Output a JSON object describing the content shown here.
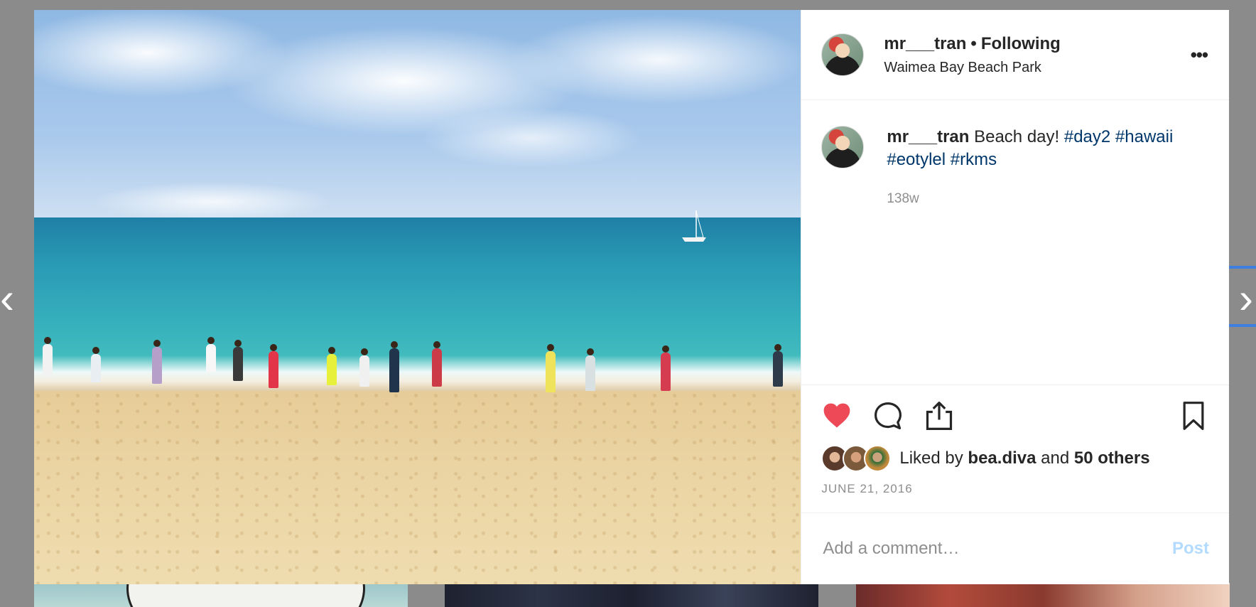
{
  "post": {
    "username": "mr___tran",
    "separator": "•",
    "follow_status": "Following",
    "location": "Waimea Bay Beach Park",
    "more_label": "•••"
  },
  "caption": {
    "username": "mr___tran",
    "text": "Beach day!",
    "hashtags": [
      "#day2",
      "#hawaii",
      "#eotylel",
      "#rkms"
    ],
    "age": "138w"
  },
  "actions": {
    "like_icon": "heart-filled-icon",
    "comment_icon": "comment-icon",
    "share_icon": "share-icon",
    "save_icon": "bookmark-icon",
    "like_color": "#ed4956"
  },
  "likes": {
    "prefix": "Liked by",
    "first_user": "bea.diva",
    "conj": "and",
    "others": "50 others"
  },
  "date": "JUNE 21, 2016",
  "comment_box": {
    "placeholder": "Add a comment…",
    "post_label": "Post"
  },
  "nav": {
    "prev": "‹",
    "next": "›"
  }
}
